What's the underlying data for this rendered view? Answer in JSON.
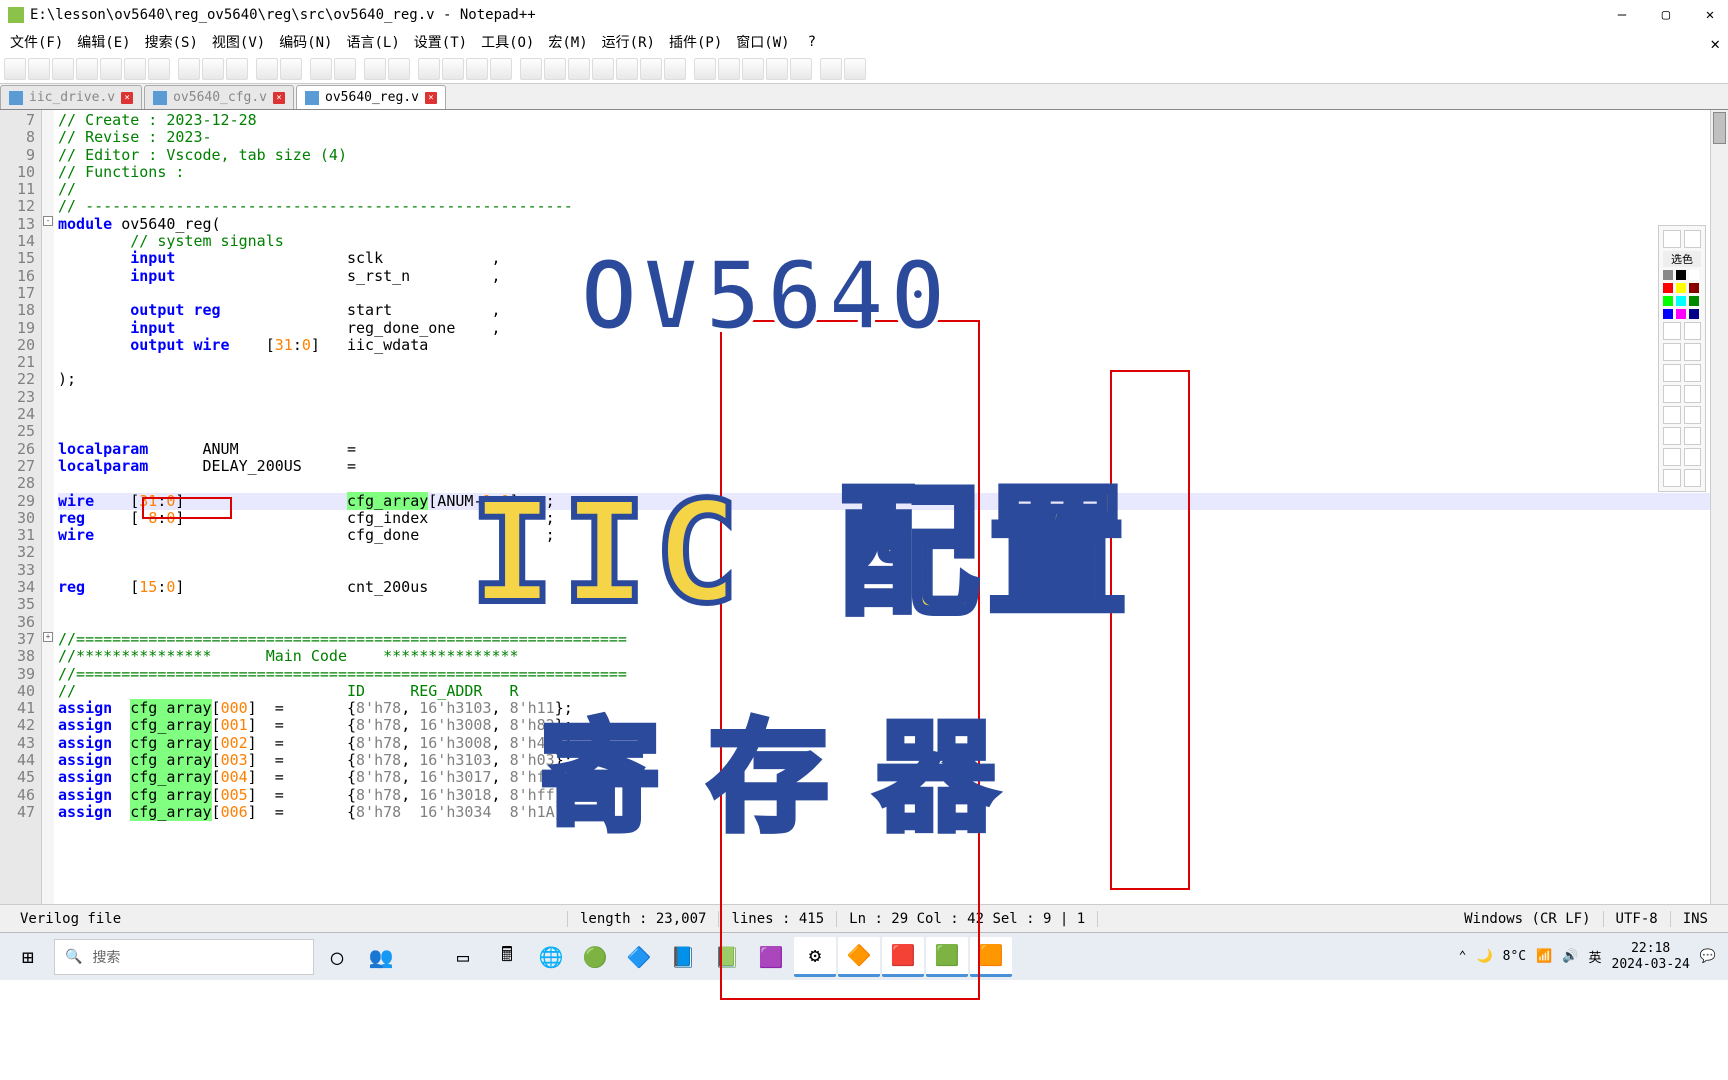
{
  "window": {
    "title": "E:\\lesson\\ov5640\\reg_ov5640\\reg\\src\\ov5640_reg.v - Notepad++"
  },
  "menu": [
    "文件(F)",
    "编辑(E)",
    "搜索(S)",
    "视图(V)",
    "编码(N)",
    "语言(L)",
    "设置(T)",
    "工具(O)",
    "宏(M)",
    "运行(R)",
    "插件(P)",
    "窗口(W)",
    "?"
  ],
  "tabs": [
    {
      "label": "iic_drive.v",
      "active": false
    },
    {
      "label": "ov5640_cfg.v",
      "active": false
    },
    {
      "label": "ov5640_reg.v",
      "active": true
    }
  ],
  "gutter_start": 7,
  "gutter_end": 47,
  "code_lines": [
    "<span class='c-comment'>// Create : 2023-12-28</span>",
    "<span class='c-comment'>// Revise : 2023-</span>",
    "<span class='c-comment'>// Editor : Vscode, tab size (4)</span>",
    "<span class='c-comment'>// Functions :</span>",
    "<span class='c-comment'>//</span>",
    "<span class='c-comment'>// ------------------------------------------------------</span>",
    "<span class='c-kw'>module</span> ov5640_reg(",
    "        <span class='c-comment'>// system signals</span>",
    "        <span class='c-kw'>input</span>                   sclk            ,",
    "        <span class='c-kw'>input</span>                   s_rst_n         ,",
    "",
    "        <span class='c-kw'>output</span> <span class='c-kw'>reg</span>              start           ,",
    "        <span class='c-kw'>input</span>                   reg_done_one    ,",
    "        <span class='c-kw'>output</span> <span class='c-kw'>wire</span>    [<span class='c-num'>31</span>:<span class='c-num'>0</span>]   iic_wdata",
    "",
    ");",
    "",
    "",
    "",
    "<span class='c-kw'>localparam</span>      ANUM            =",
    "<span class='c-kw'>localparam</span>      DELAY_200US     =",
    "",
    "<span class='c-kw'>wire</span>    [<span class='c-num'>31</span>:<span class='c-num'>0</span>]                  <span class='c-hl'>cfg_array</span>[ANUM-<span class='c-num'>1</span>:<span class='c-num'>0</span>]   ;",
    "<span class='c-kw'>reg</span>     [ <span class='c-num'>8</span>:<span class='c-num'>0</span>]                  cfg_index             ;",
    "<span class='c-kw'>wire</span>                            cfg_done              ;",
    "",
    "",
    "<span class='c-kw'>reg</span>     [<span class='c-num'>15</span>:<span class='c-num'>0</span>]                  cnt_200us",
    "",
    "",
    "<span class='c-comment'>//=============================================================</span>",
    "<span class='c-comment'>//***************      Main Code    ***************</span>",
    "<span class='c-comment'>//=============================================================</span>",
    "<span class='c-comment'>//                              ID     REG_ADDR   R</span>",
    "<span class='c-kw'>assign</span>  <span class='c-hl'>cfg_array</span>[<span class='c-num'>000</span>]  =       {<span class='c-str'>8'h78</span>, <span class='c-str'>16'h3103</span>, <span class='c-str'>8'h11</span>};",
    "<span class='c-kw'>assign</span>  <span class='c-hl'>cfg_array</span>[<span class='c-num'>001</span>]  =       {<span class='c-str'>8'h78</span>, <span class='c-str'>16'h3008</span>, <span class='c-str'>8'h82</span>};",
    "<span class='c-kw'>assign</span>  <span class='c-hl'>cfg_array</span>[<span class='c-num'>002</span>]  =       {<span class='c-str'>8'h78</span>, <span class='c-str'>16'h3008</span>, <span class='c-str'>8'h42</span>};",
    "<span class='c-kw'>assign</span>  <span class='c-hl'>cfg_array</span>[<span class='c-num'>003</span>]  =       {<span class='c-str'>8'h78</span>, <span class='c-str'>16'h3103</span>, <span class='c-str'>8'h03</span>};",
    "<span class='c-kw'>assign</span>  <span class='c-hl'>cfg_array</span>[<span class='c-num'>004</span>]  =       {<span class='c-str'>8'h78</span>, <span class='c-str'>16'h3017</span>, <span class='c-str'>8'hff</span>};",
    "<span class='c-kw'>assign</span>  <span class='c-hl'>cfg_array</span>[<span class='c-num'>005</span>]  =       {<span class='c-str'>8'h78</span>, <span class='c-str'>16'h3018</span>, <span class='c-str'>8'hff</span>};",
    "<span class='c-kw'>assign</span>  <span class='c-hl'>cfg_array</span>[<span class='c-num'>006</span>]  =       {<span class='c-str'>8'h78</span>  <span class='c-str'>16'h3034</span>  <span class='c-str'>8'h1A</span>};"
  ],
  "status": {
    "lang": "Verilog file",
    "length": "length : 23,007",
    "lines": "lines : 415",
    "pos": "Ln : 29    Col : 42    Sel : 9 | 1",
    "eol": "Windows (CR LF)",
    "enc": "UTF-8",
    "mode": "INS"
  },
  "taskbar": {
    "search_placeholder": "搜索",
    "temp": "8°C",
    "time": "22:18",
    "date": "2024-03-24"
  },
  "overlays": {
    "top": "OV5640",
    "mid": "IIC 配置",
    "bot": "寄存器"
  },
  "side_panel": {
    "label": "选色"
  }
}
